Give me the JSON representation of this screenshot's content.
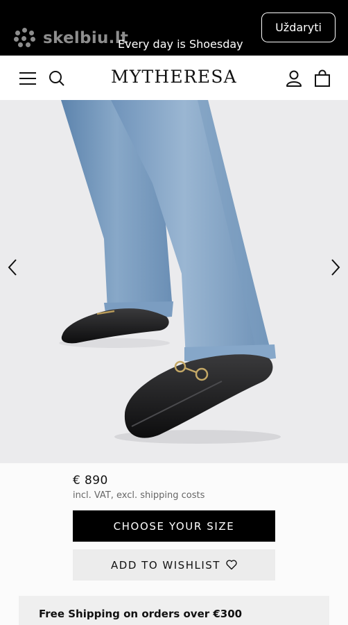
{
  "overlay": {
    "brand": "skelbiu.lt",
    "close_label": "Uždaryti"
  },
  "promo": {
    "text": "Every day is Shoesday"
  },
  "header": {
    "logo": "MYTHERESA",
    "icons": [
      "menu-icon",
      "search-icon",
      "account-icon",
      "shopping-bag-icon"
    ]
  },
  "gallery": {
    "prev_icon": "chevron-left-icon",
    "next_icon": "chevron-right-icon"
  },
  "product": {
    "price": "€ 890",
    "tax_note": "incl. VAT, excl. shipping costs",
    "choose_size_label": "CHOOSE YOUR SIZE",
    "wishlist_label": "ADD TO WISHLIST",
    "wishlist_icon": "heart-icon"
  },
  "shipping": {
    "text": "Free Shipping on orders over €300"
  },
  "colors": {
    "promo_bg": "#000000",
    "primary_button": "#000000",
    "secondary_button": "#ececec",
    "image_bg": "#ebebed"
  }
}
